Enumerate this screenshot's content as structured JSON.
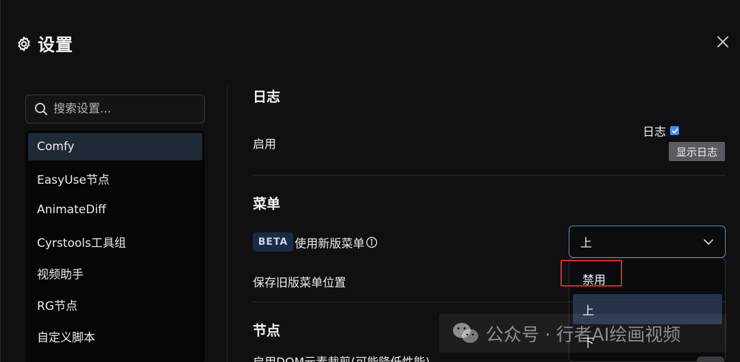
{
  "dialog": {
    "title": "设置",
    "icons": {
      "title": "gear-icon",
      "close": "close-icon"
    }
  },
  "sidebar": {
    "search_placeholder": "搜索设置...",
    "items": [
      {
        "label": "Comfy",
        "active": true
      },
      {
        "label": "EasyUse节点"
      },
      {
        "label": "AnimateDiff"
      },
      {
        "label": "Cyrstools工具组"
      },
      {
        "label": "视频助手"
      },
      {
        "label": "RG节点"
      },
      {
        "label": "自定义脚本"
      }
    ]
  },
  "content": {
    "log_section": {
      "title": "日志",
      "enable_label": "启用",
      "checkbox_label": "日志",
      "checkbox_checked": true,
      "show_log_button": "显示日志"
    },
    "menu_section": {
      "title": "菜单",
      "beta_badge": "BETA",
      "new_menu_label": "使用新版菜单",
      "new_menu_value": "上",
      "save_position_label": "保存旧版菜单位置",
      "dropdown_options": [
        "禁用",
        "上",
        "下"
      ],
      "selected_option": "上"
    },
    "node_section": {
      "title": "节点",
      "partial_row_label": "启用DOM元素裁剪(可能降低性能)"
    }
  },
  "overlay": {
    "watermark_text": "公众号 · 行者AI绘画视频",
    "highlight_color": "#e4271f"
  },
  "colors": {
    "background": "#101012",
    "accent": "#5b8fd8",
    "active_item": "#1f2937",
    "selected_option": "#26344b"
  }
}
